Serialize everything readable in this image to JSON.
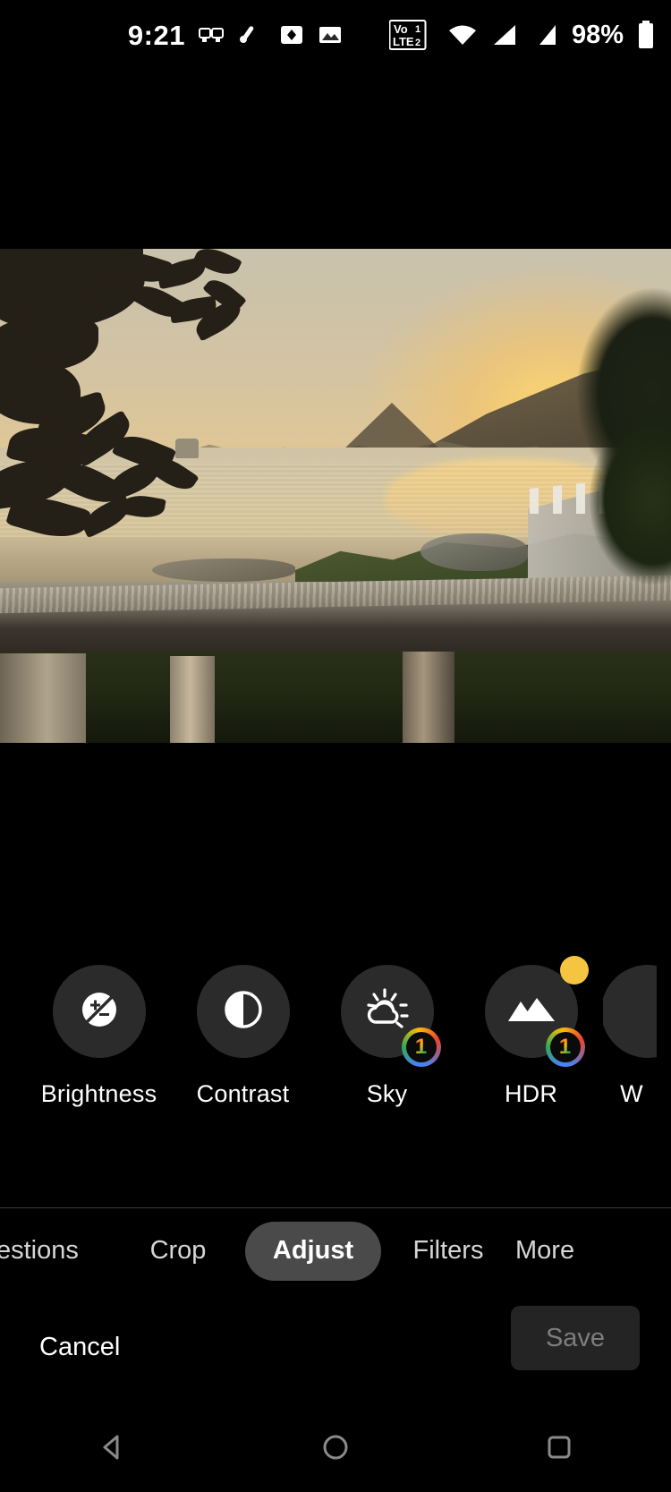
{
  "status_bar": {
    "time": "9:21",
    "battery_percent": "98%",
    "network_label": "VoLTE",
    "sim1": "1",
    "sim2": "2",
    "icons": [
      "screen-cast-icon",
      "do-not-disturb-icon",
      "vibrate-icon",
      "photo-icon",
      "volte-icon",
      "wifi-icon",
      "signal-sim1-icon",
      "signal-sim2-icon",
      "battery-icon"
    ]
  },
  "photo": {
    "description": "Sunset over a lake with hills, a concrete railing in the foreground and tree silhouettes framing the edges",
    "alt": "photo-preview"
  },
  "adjust_tools": [
    {
      "id": "brightness",
      "label": "Brightness",
      "icon": "exposure-icon",
      "badge": null,
      "dot": false
    },
    {
      "id": "contrast",
      "label": "Contrast",
      "icon": "contrast-icon",
      "badge": null,
      "dot": false
    },
    {
      "id": "sky",
      "label": "Sky",
      "icon": "sky-sun-icon",
      "badge": "1",
      "dot": false
    },
    {
      "id": "hdr",
      "label": "HDR",
      "icon": "landscape-hdr-icon",
      "badge": "1",
      "dot": true
    },
    {
      "id": "warmth",
      "label": "W",
      "icon": "warmth-icon",
      "badge": null,
      "dot": false
    }
  ],
  "mode_tabs": [
    {
      "id": "suggestions",
      "label": "estions",
      "active": false
    },
    {
      "id": "crop",
      "label": "Crop",
      "active": false
    },
    {
      "id": "adjust",
      "label": "Adjust",
      "active": true
    },
    {
      "id": "filters",
      "label": "Filters",
      "active": false
    },
    {
      "id": "more",
      "label": "More",
      "active": false
    }
  ],
  "actions": {
    "cancel_label": "Cancel",
    "save_label": "Save",
    "save_enabled": false
  },
  "nav_bar": {
    "back": "back-icon",
    "home": "home-icon",
    "recents": "recents-icon"
  },
  "colors": {
    "background": "#000000",
    "tool_circle": "#2b2b2b",
    "active_tab": "#4a4a4a",
    "save_bg": "#242424",
    "save_text": "#7d7d7d",
    "badge_dot": "#f5c542"
  }
}
